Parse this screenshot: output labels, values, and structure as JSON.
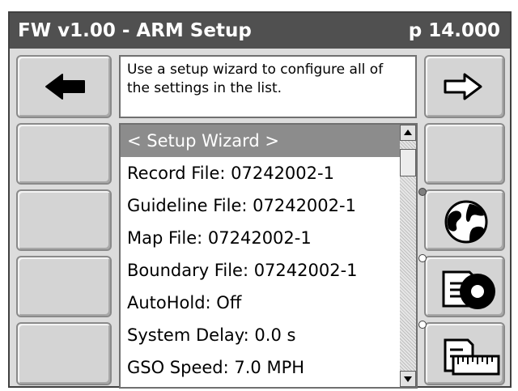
{
  "titlebar": {
    "title": "FW v1.00 - ARM Setup",
    "page": "p 14.000"
  },
  "info": {
    "text": "Use a setup wizard to configure all of the settings in the list."
  },
  "list": {
    "items": [
      "< Setup Wizard >",
      "Record File: 07242002-1",
      "Guideline File: 07242002-1",
      "Map File: 07242002-1",
      "Boundary File: 07242002-1",
      "AutoHold: Off",
      "System Delay: 0.0 s",
      "GSO Speed: 7.0 MPH"
    ],
    "selected_index": 0
  },
  "icons": {
    "back": "left-arrow-icon",
    "forward": "right-arrow-icon",
    "globe": "globe-icon",
    "disk": "file-disk-icon",
    "ruler": "ruler-icon"
  },
  "colors": {
    "titlebar": "#505050",
    "selection": "#8c8c8c",
    "panel": "#dcdcdc"
  }
}
